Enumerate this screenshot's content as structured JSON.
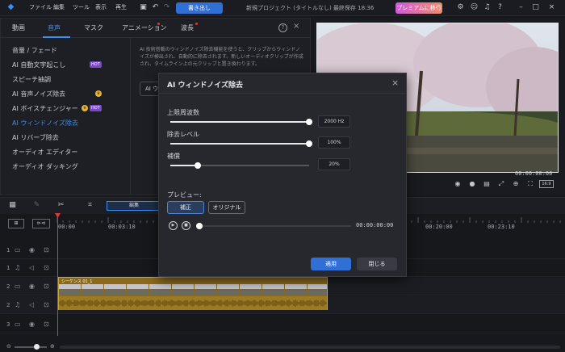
{
  "menu": {
    "file": "ファイル",
    "edit": "編集",
    "tools": "ツール",
    "view": "表示",
    "play": "再生"
  },
  "header": {
    "export": "書き出し",
    "project": "新規プロジェクト (タイトルなし) 最終保存 18:36",
    "premium": "プレミアムに移行"
  },
  "tabs": [
    "動画",
    "音声",
    "マスク",
    "アニメーション",
    "波長"
  ],
  "side_items": [
    "音量 / フェード",
    "AI 自動文字起こし",
    "スピーチ抽調",
    "AI 音声ノイズ除去",
    "AI ボイスチェンジャー",
    "AI ウィンドノイズ除去",
    "AI リバーブ除去",
    "オーディオ エディター",
    "オーディオ ダッキング"
  ],
  "badges": {
    "hot": "HOT"
  },
  "description": "AI 技術搭載のウィンドノイズ除去機能を使うと、クリップからウィンドノイズが検出され、自動的に除去されます。新しいオーディオクリップが作成され、タイムライン上の元クリップと置き換わります。",
  "panel_button_fragment": "AI ウ",
  "preview": {
    "timecode": "00:00:00:00",
    "ratio": "16:9"
  },
  "timeline": {
    "tool_label": "編集",
    "ticks": [
      "00:00",
      "00:03:10",
      "00:20:00",
      "00:23:10"
    ],
    "track_numbers": [
      "1",
      "1",
      "2",
      "2",
      "3"
    ],
    "clip_label": "シーケンス 01_1"
  },
  "dialog": {
    "title": "AI ウィンドノイズ除去",
    "upper_freq_label": "上限周波数",
    "upper_freq_value": "2000 Hz",
    "upper_freq_fraction": 1.0,
    "level_label": "除去レベル",
    "level_value": "100%",
    "level_fraction": 1.0,
    "comp_label": "補償",
    "comp_value": "20%",
    "comp_fraction": 0.2,
    "preview_label": "プレビュー:",
    "after_btn": "補正",
    "original_btn": "オリジナル",
    "timecode": "00:00:00:00",
    "apply": "適用",
    "close": "閉じる"
  }
}
